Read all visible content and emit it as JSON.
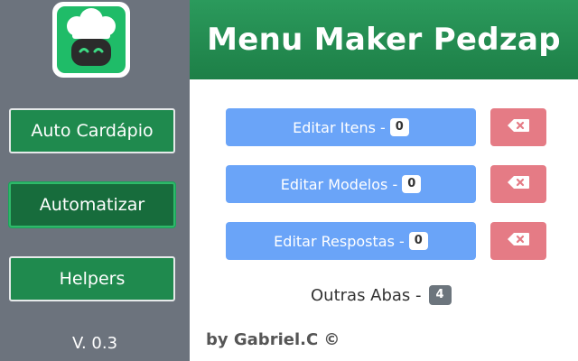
{
  "sidebar": {
    "logo_icon": "chef-robot-icon",
    "items": [
      {
        "label": "Auto Cardápio"
      },
      {
        "label": "Automatizar"
      },
      {
        "label": "Helpers"
      }
    ],
    "version": "V. 0.3"
  },
  "header": {
    "title": "Menu Maker Pedzap"
  },
  "main": {
    "rows": [
      {
        "label": "Editar Itens -",
        "count": "0",
        "delete_icon": "backspace-x-icon"
      },
      {
        "label": "Editar Modelos -",
        "count": "0",
        "delete_icon": "backspace-x-icon"
      },
      {
        "label": "Editar Respostas -",
        "count": "0",
        "delete_icon": "backspace-x-icon"
      }
    ],
    "other_tabs": {
      "label": "Outras Abas -",
      "count": "4"
    },
    "credit": "by Gabriel.C ©"
  },
  "colors": {
    "sidebar_bg": "#6c737d",
    "green_primary": "#1f8a4e",
    "blue_button": "#6aa4f8",
    "red_button": "#e57b85",
    "logo_green": "#1fbc68"
  }
}
